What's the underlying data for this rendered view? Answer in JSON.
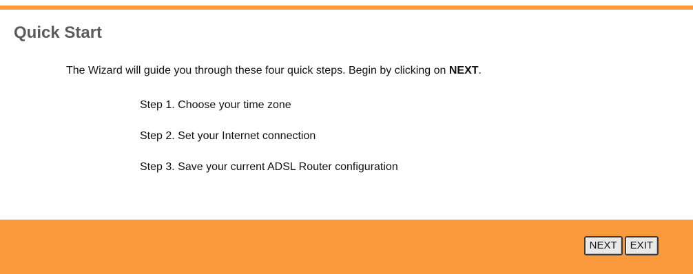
{
  "page": {
    "title": "Quick Start",
    "intro_text": "The Wizard will guide you through these four quick steps. Begin by clicking on ",
    "intro_emphasis": "NEXT",
    "intro_end": ".",
    "steps": [
      "Step 1. Choose your time zone",
      "Step 2. Set your Internet connection",
      "Step 3. Save your current ADSL Router configuration"
    ]
  },
  "buttons": {
    "next_label": "NEXT",
    "exit_label": "EXIT"
  },
  "colors": {
    "accent": "#fb9a3c",
    "title_text": "#5b5b5b",
    "body_text": "#111111"
  }
}
